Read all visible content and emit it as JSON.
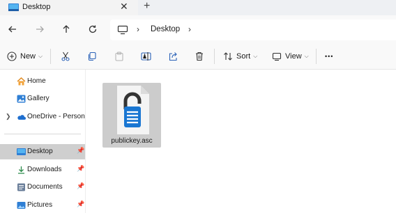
{
  "tab": {
    "title": "Desktop",
    "close_glyph": "✕",
    "new_tab_glyph": "+"
  },
  "address": {
    "segments": [
      "Desktop"
    ],
    "separator": "›",
    "root_icon": "computer-icon"
  },
  "toolbar": {
    "new_label": "New",
    "sort_label": "Sort",
    "view_label": "View",
    "more_glyph": "•••"
  },
  "sidebar": {
    "items": [
      {
        "label": "Home",
        "icon": "home-icon"
      },
      {
        "label": "Gallery",
        "icon": "gallery-icon"
      },
      {
        "label": "OneDrive - Persona",
        "icon": "onedrive-icon",
        "expandable": true
      },
      {
        "label": "Desktop",
        "icon": "desktop-folder-icon",
        "pinned": true,
        "selected": true
      },
      {
        "label": "Downloads",
        "icon": "download-icon",
        "pinned": true
      },
      {
        "label": "Documents",
        "icon": "documents-icon",
        "pinned": true
      },
      {
        "label": "Pictures",
        "icon": "pictures-icon",
        "pinned": true
      }
    ]
  },
  "files": [
    {
      "name": "publickey.asc",
      "icon": "locked-document-icon",
      "selected": true
    }
  ],
  "colors": {
    "accent": "#1976d2",
    "selected_row": "#cfcfcf",
    "lock": "#333333"
  }
}
